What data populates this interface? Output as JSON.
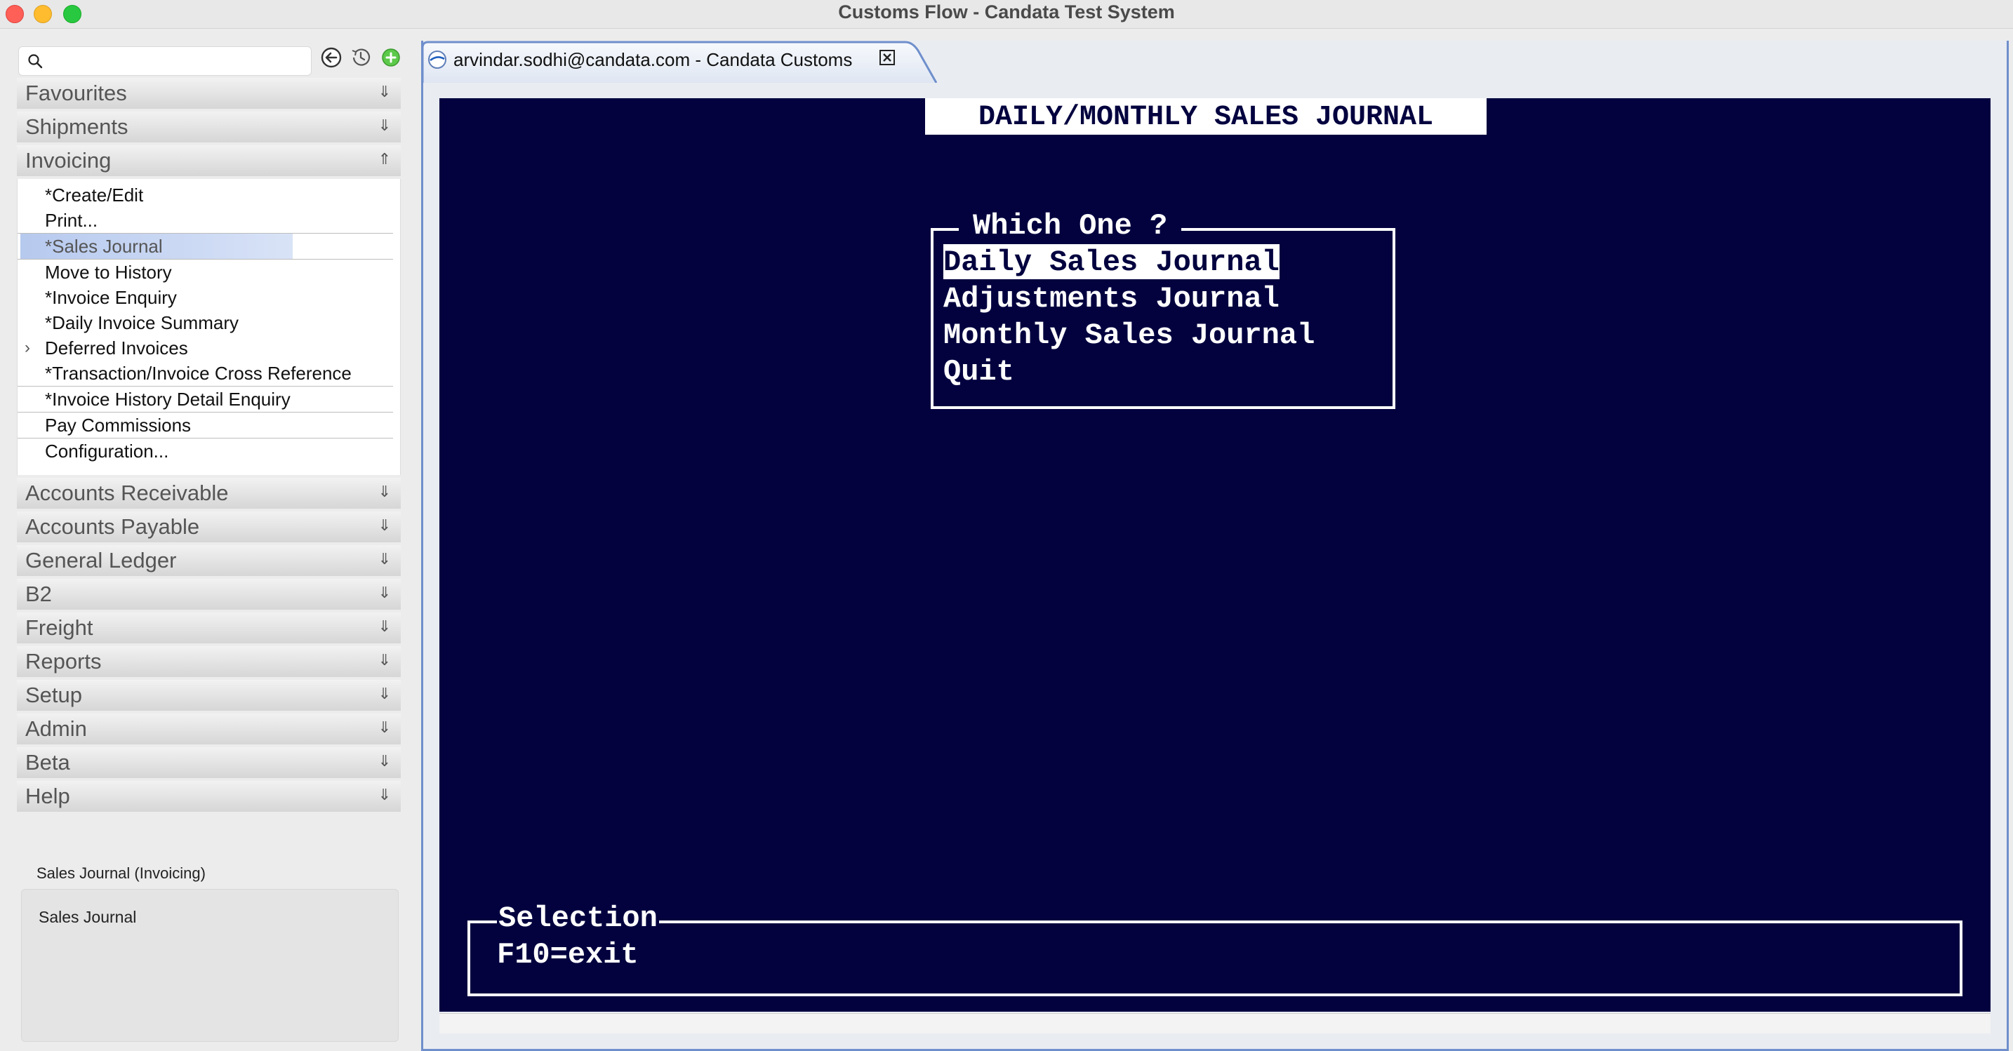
{
  "window": {
    "title": "Customs Flow - Candata Test System"
  },
  "search": {
    "placeholder": ""
  },
  "sidebar": {
    "sections": [
      {
        "label": "Favourites"
      },
      {
        "label": "Shipments"
      },
      {
        "label": "Invoicing"
      },
      {
        "label": "Accounts Receivable"
      },
      {
        "label": "Accounts Payable"
      },
      {
        "label": "General Ledger"
      },
      {
        "label": "B2"
      },
      {
        "label": "Freight"
      },
      {
        "label": "Reports"
      },
      {
        "label": "Setup"
      },
      {
        "label": "Admin"
      },
      {
        "label": "Beta"
      },
      {
        "label": "Help"
      }
    ],
    "invoicing_items": [
      {
        "label": "*Create/Edit"
      },
      {
        "label": "Print..."
      },
      {
        "label": "*Sales Journal"
      },
      {
        "label": "Move to History"
      },
      {
        "label": "*Invoice Enquiry"
      },
      {
        "label": "*Daily Invoice Summary"
      },
      {
        "label": "Deferred Invoices"
      },
      {
        "label": "*Transaction/Invoice Cross Reference"
      },
      {
        "label": "*Invoice History Detail Enquiry"
      },
      {
        "label": "Pay Commissions"
      },
      {
        "label": "Configuration..."
      }
    ]
  },
  "status": {
    "caption": "Sales Journal (Invoicing)",
    "description": "Sales Journal"
  },
  "tab": {
    "label": "arvindar.sodhi@candata.com - Candata Customs"
  },
  "terminal": {
    "title": "DAILY/MONTHLY SALES JOURNAL",
    "menu_title": "Which One ?",
    "options": [
      {
        "label": "Daily Sales Journal"
      },
      {
        "label": "Adjustments Journal"
      },
      {
        "label": "Monthly Sales Journal"
      },
      {
        "label": "Quit"
      }
    ],
    "selection_label": "Selection",
    "exit_hint": "F10=exit"
  },
  "colors": {
    "terminal_bg": "#03023f",
    "selection_highlight": "#b6c9ee",
    "tab_border": "#6f8fcc"
  }
}
